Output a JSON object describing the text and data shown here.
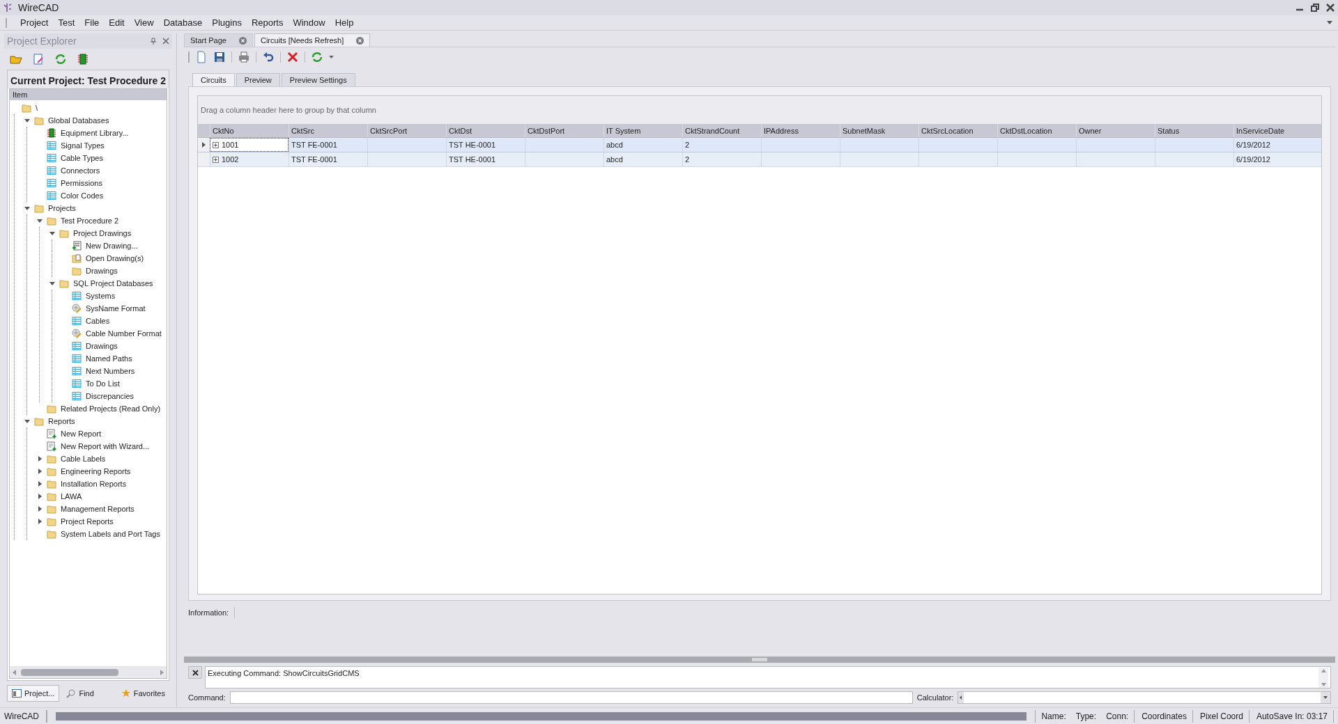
{
  "window": {
    "title": "WireCAD"
  },
  "menu": [
    "Project",
    "Test",
    "File",
    "Edit",
    "View",
    "Database",
    "Plugins",
    "Reports",
    "Window",
    "Help"
  ],
  "explorer": {
    "title": "Project Explorer",
    "current_project": "Current Project: Test Procedure 2",
    "tree_header": "Item",
    "tree": [
      {
        "label": "\\",
        "kind": "folder",
        "children": [
          {
            "label": "Global Databases",
            "kind": "folder",
            "expanded": true,
            "children": [
              {
                "label": "Equipment Library...",
                "kind": "chip"
              },
              {
                "label": "Signal Types",
                "kind": "table"
              },
              {
                "label": "Cable Types",
                "kind": "table"
              },
              {
                "label": "Connectors",
                "kind": "table"
              },
              {
                "label": "Permissions",
                "kind": "table"
              },
              {
                "label": "Color Codes",
                "kind": "table"
              }
            ]
          },
          {
            "label": "Projects",
            "kind": "folder",
            "expanded": true,
            "children": [
              {
                "label": "Test Procedure 2",
                "kind": "folder",
                "expanded": true,
                "children": [
                  {
                    "label": "Project Drawings",
                    "kind": "folder",
                    "expanded": true,
                    "children": [
                      {
                        "label": "New Drawing...",
                        "kind": "new-drawing"
                      },
                      {
                        "label": "Open Drawing(s)",
                        "kind": "open-drawing"
                      },
                      {
                        "label": "Drawings",
                        "kind": "folder"
                      }
                    ]
                  },
                  {
                    "label": "SQL Project Databases",
                    "kind": "folder",
                    "expanded": true,
                    "children": [
                      {
                        "label": "Systems",
                        "kind": "table"
                      },
                      {
                        "label": "SysName Format",
                        "kind": "format"
                      },
                      {
                        "label": "Cables",
                        "kind": "table"
                      },
                      {
                        "label": "Cable Number Format",
                        "kind": "format"
                      },
                      {
                        "label": "Drawings",
                        "kind": "table"
                      },
                      {
                        "label": "Named Paths",
                        "kind": "table"
                      },
                      {
                        "label": "Next Numbers",
                        "kind": "table"
                      },
                      {
                        "label": "To Do List",
                        "kind": "table"
                      },
                      {
                        "label": "Discrepancies",
                        "kind": "table"
                      }
                    ]
                  }
                ]
              },
              {
                "label": "Related Projects (Read Only)",
                "kind": "folder"
              }
            ]
          },
          {
            "label": "Reports",
            "kind": "folder",
            "expanded": true,
            "children": [
              {
                "label": "New Report",
                "kind": "report"
              },
              {
                "label": "New Report with Wizard...",
                "kind": "report"
              },
              {
                "label": "Cable Labels",
                "kind": "folder",
                "expanded": false
              },
              {
                "label": "Engineering Reports",
                "kind": "folder",
                "expanded": false
              },
              {
                "label": "Installation Reports",
                "kind": "folder",
                "expanded": false
              },
              {
                "label": "LAWA",
                "kind": "folder",
                "expanded": false
              },
              {
                "label": "Management Reports",
                "kind": "folder",
                "expanded": false
              },
              {
                "label": "Project Reports",
                "kind": "folder",
                "expanded": false
              },
              {
                "label": "System Labels and Port Tags",
                "kind": "folder"
              }
            ]
          }
        ]
      }
    ],
    "bottom_tabs": [
      {
        "label": "Project...",
        "selected": true
      },
      {
        "label": "Find",
        "selected": false
      },
      {
        "label": "Favorites",
        "selected": false
      }
    ]
  },
  "doc_tabs": [
    {
      "label": "Start Page",
      "selected": false
    },
    {
      "label": "Circuits [Needs Refresh]",
      "selected": true
    }
  ],
  "view_tabs": [
    {
      "label": "Circuits",
      "selected": true
    },
    {
      "label": "Preview",
      "selected": false
    },
    {
      "label": "Preview Settings",
      "selected": false
    }
  ],
  "grid": {
    "group_hint": "Drag a column header here to group by that column",
    "columns": [
      "CktNo",
      "CktSrc",
      "CktSrcPort",
      "CktDst",
      "CktDstPort",
      "IT System",
      "CktStrandCount",
      "IPAddress",
      "SubnetMask",
      "CktSrcLocation",
      "CktDstLocation",
      "Owner",
      "Status",
      "InServiceDate"
    ],
    "rows": [
      {
        "selected": true,
        "cells": [
          "1001",
          "TST FE-0001",
          "",
          "TST HE-0001",
          "",
          "abcd",
          "2",
          "",
          "",
          "",
          "",
          "",
          "",
          "6/19/2012"
        ]
      },
      {
        "selected": false,
        "cells": [
          "1002",
          "TST FE-0001",
          "",
          "TST HE-0001",
          "",
          "abcd",
          "2",
          "",
          "",
          "",
          "",
          "",
          "",
          "6/19/2012"
        ]
      }
    ]
  },
  "information": {
    "label": "Information:"
  },
  "console": {
    "output": "Executing Command: ShowCircuitsGridCMS",
    "command_label": "Command:",
    "calculator_label": "Calculator:"
  },
  "status_bar": {
    "app": "WireCAD",
    "progress": {
      "level": 1
    },
    "fields": [
      "Name:",
      "Type:",
      "Conn:",
      "Coordinates",
      "Pixel Coord",
      "AutoSave In: 03:17"
    ]
  }
}
